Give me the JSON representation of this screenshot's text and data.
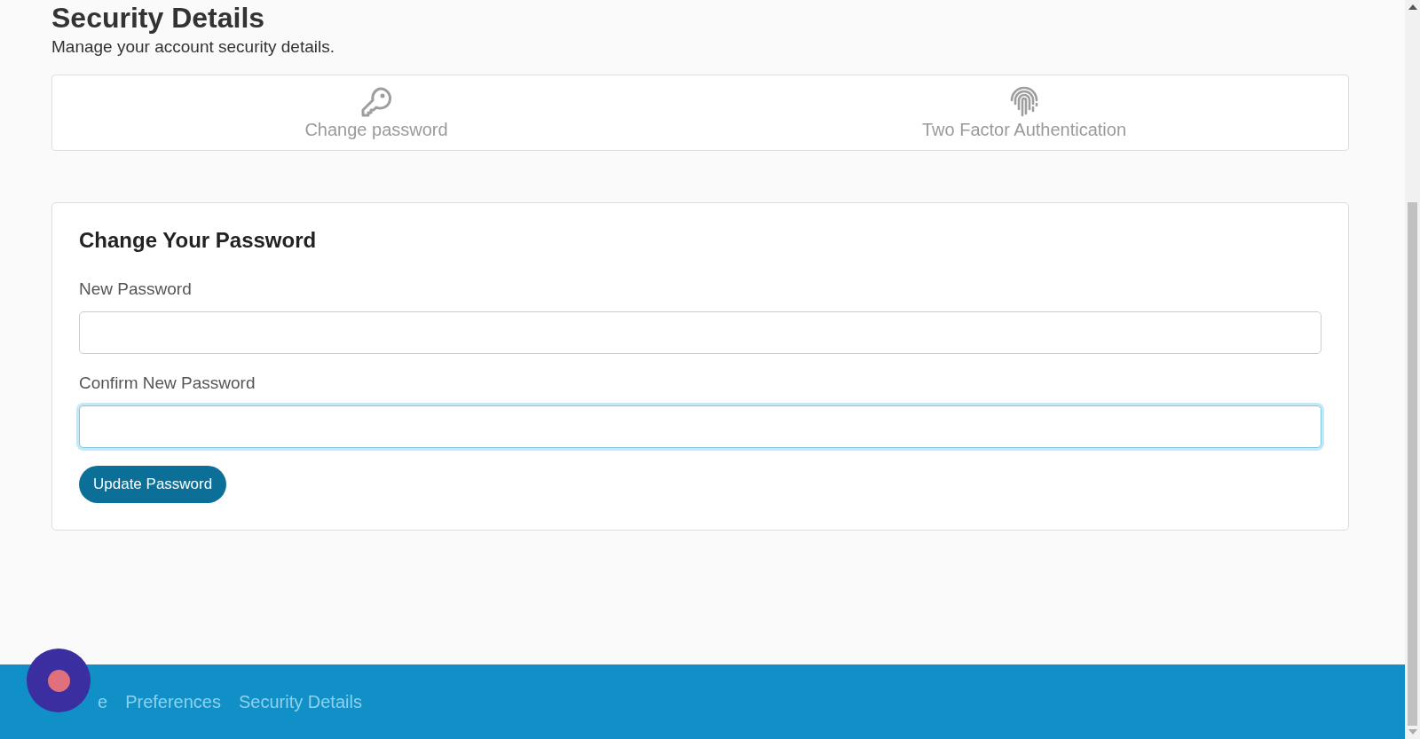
{
  "page": {
    "title": "Security Details",
    "subtitle": "Manage your account security details."
  },
  "tabs": [
    {
      "label": "Change password"
    },
    {
      "label": "Two Factor Authentication"
    }
  ],
  "form": {
    "title": "Change Your Password",
    "fields": [
      {
        "label": "New Password",
        "focused": false
      },
      {
        "label": "Confirm New Password",
        "focused": true
      }
    ],
    "button": "Update Password"
  },
  "footer": {
    "links": [
      "e",
      "Preferences",
      "Security Details"
    ]
  }
}
